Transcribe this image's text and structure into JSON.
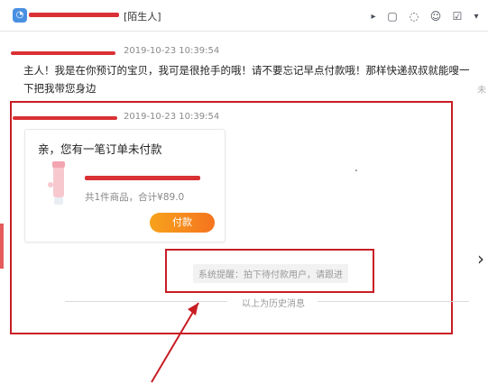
{
  "window": {
    "title": "[陌生人]",
    "toolbar_icons": [
      "play-icon",
      "file-icon",
      "chat-icon",
      "user-icon",
      "check-icon",
      "dropdown-icon"
    ]
  },
  "messages": [
    {
      "time": "2019-10-23 10:39:54",
      "text": "主人！我是在你预订的宝贝，我可是很抢手的哦！请不要忘记早点付款哦！那样快递叔叔就能嗖一下把我带您身边"
    },
    {
      "time": "2019-10-23 10:39:54"
    }
  ],
  "side_mark": "未",
  "order_card": {
    "title": "亲，您有一笔订单未付款",
    "subtitle": "共1件商品，合计¥89.0",
    "pay_button": "付款"
  },
  "system_tip": "系统提醒：拍下待付款用户，请跟进",
  "history_divider": "以上为历史消息",
  "colors": {
    "accent": "#c81d25",
    "pay_gradient_start": "#f7a21c",
    "pay_gradient_end": "#f5741f"
  }
}
